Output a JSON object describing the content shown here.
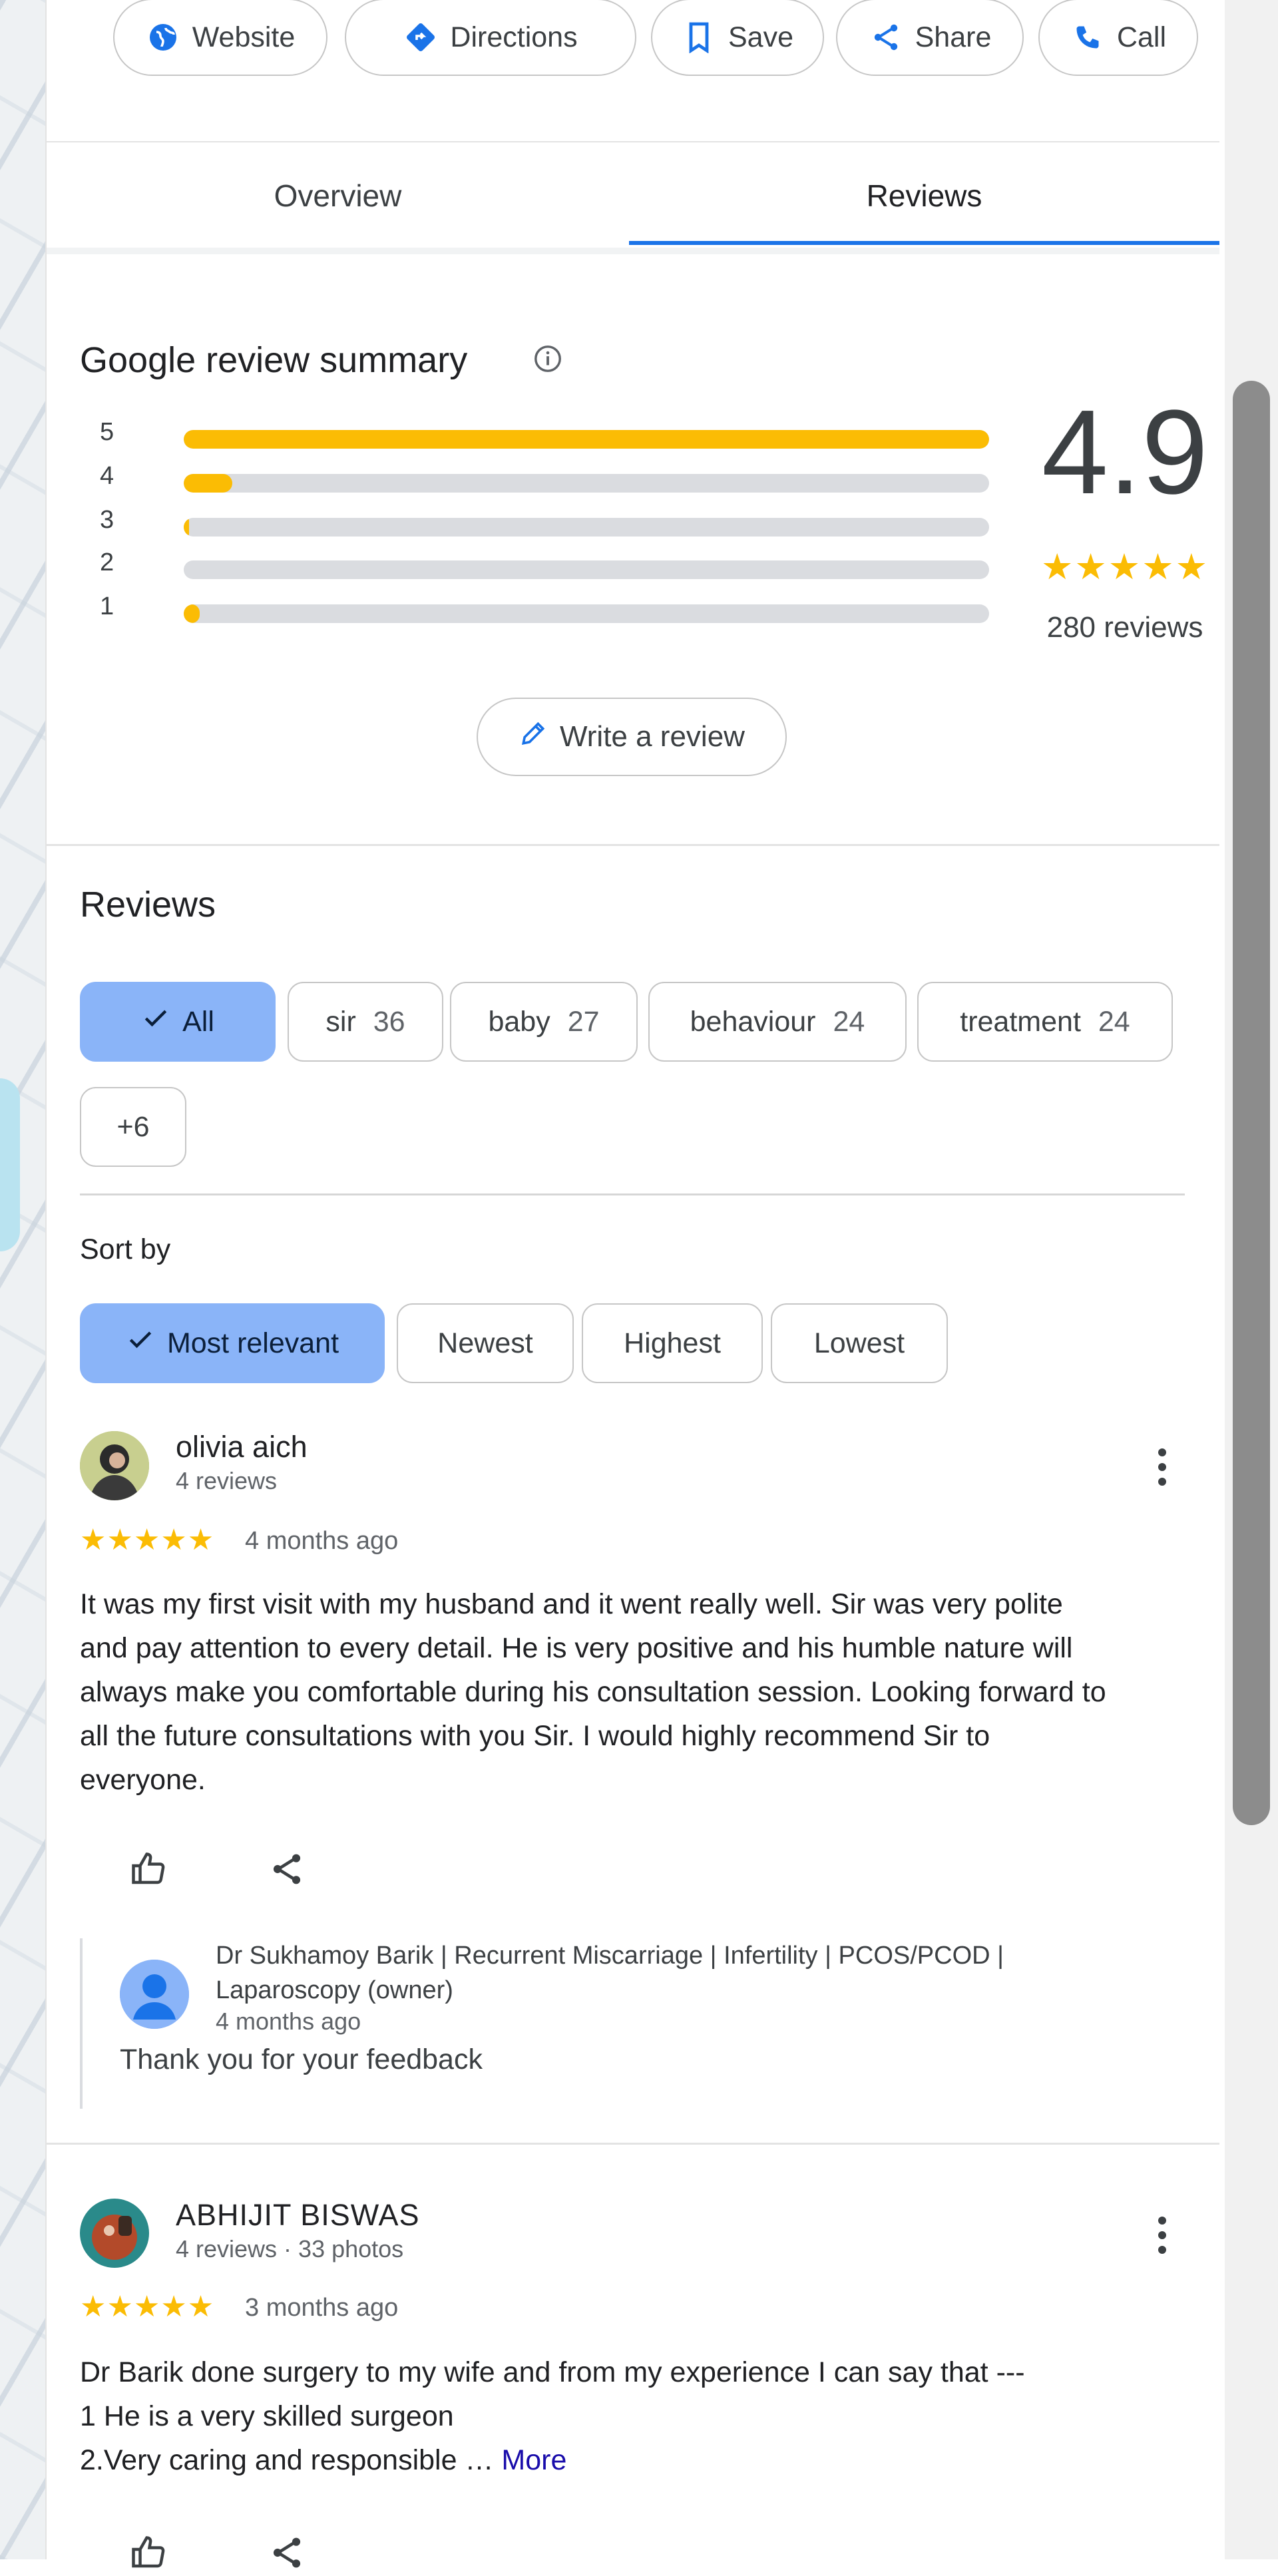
{
  "actions": [
    {
      "label": "Website",
      "icon": "globe-icon"
    },
    {
      "label": "Directions",
      "icon": "directions-icon"
    },
    {
      "label": "Save",
      "icon": "bookmark-icon"
    },
    {
      "label": "Share",
      "icon": "share-icon"
    },
    {
      "label": "Call",
      "icon": "phone-icon"
    }
  ],
  "tabs": [
    {
      "label": "Overview",
      "active": false
    },
    {
      "label": "Reviews",
      "active": true
    }
  ],
  "summary": {
    "title": "Google review summary",
    "rating": "4.9",
    "stars": "★★★★★",
    "count_text": "280 reviews",
    "distribution": [
      {
        "star": "5",
        "fraction": 1.0
      },
      {
        "star": "4",
        "fraction": 0.06
      },
      {
        "star": "3",
        "fraction": 0.005
      },
      {
        "star": "2",
        "fraction": 0.0
      },
      {
        "star": "1",
        "fraction": 0.02
      }
    ],
    "write_review_label": "Write a review"
  },
  "reviews_section": {
    "title": "Reviews",
    "topics": [
      {
        "label": "All",
        "count": "",
        "selected": true
      },
      {
        "label": "sir",
        "count": "36",
        "selected": false
      },
      {
        "label": "baby",
        "count": "27",
        "selected": false
      },
      {
        "label": "behaviour",
        "count": "24",
        "selected": false
      },
      {
        "label": "treatment",
        "count": "24",
        "selected": false
      },
      {
        "label": "+6",
        "count": "",
        "selected": false
      }
    ],
    "sort_label": "Sort by",
    "sort_options": [
      {
        "label": "Most relevant",
        "selected": true
      },
      {
        "label": "Newest",
        "selected": false
      },
      {
        "label": "Highest",
        "selected": false
      },
      {
        "label": "Lowest",
        "selected": false
      }
    ]
  },
  "reviews": [
    {
      "name": "olivia aich",
      "meta": "4 reviews",
      "stars": "★★★★★",
      "rating": 5,
      "date": "4 months ago",
      "text_lines": [
        "It was my first visit with my husband and it went really well. Sir was very polite",
        "and pay attention to every detail. He is very positive and his humble nature will",
        "always make you comfortable during his consultation session. Looking forward to",
        "all the future consultations with you Sir. I would highly recommend Sir to",
        "everyone."
      ],
      "owner_reply": {
        "name_line1": "Dr Sukhamoy Barik | Recurrent Miscarriage | Infertility | PCOS/PCOD |",
        "name_line2": "Laparoscopy (owner)",
        "date": "4 months ago",
        "text": "Thank you for your feedback"
      }
    },
    {
      "name": "ABHIJIT BISWAS",
      "meta": "4 reviews · 33 photos",
      "stars": "★★★★★",
      "rating": 5,
      "date": "3 months ago",
      "text_lines": [
        "Dr Barik done surgery to my wife and from my experience I can say that ---",
        "1 He is a very skilled surgeon",
        "2.Very caring and responsible … "
      ],
      "more_label": "More"
    }
  ]
}
